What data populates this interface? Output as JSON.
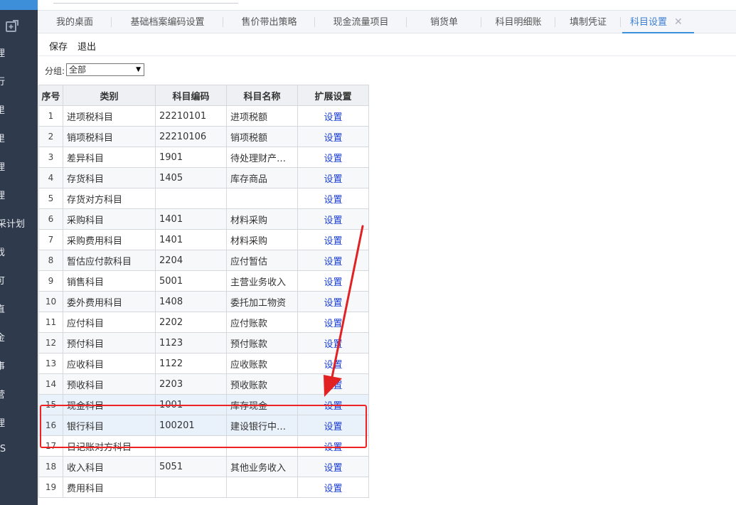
{
  "sidebar": {
    "items": [
      "理",
      "行",
      "里",
      "里",
      "理",
      "理",
      "采计划",
      "戏",
      "可",
      "直",
      "金",
      "事",
      "营",
      "理",
      "IS"
    ]
  },
  "tabs": [
    {
      "label": "我的桌面"
    },
    {
      "label": "基础档案编码设置"
    },
    {
      "label": "售价带出策略"
    },
    {
      "label": "现金流量项目"
    },
    {
      "label": "销货单"
    },
    {
      "label": "科目明细账"
    },
    {
      "label": "填制凭证"
    },
    {
      "label": "科目设置",
      "active": true,
      "close": "✕"
    }
  ],
  "toolbar": {
    "save_label": "保存",
    "exit_label": "退出"
  },
  "filter": {
    "label": "分组:",
    "selected": "全部"
  },
  "table": {
    "headers": [
      "序号",
      "类别",
      "科目编码",
      "科目名称",
      "扩展设置"
    ],
    "rows": [
      {
        "idx": "1",
        "category": "进项税科目",
        "code": "22210101",
        "name": "进项税额",
        "action": "设置"
      },
      {
        "idx": "2",
        "category": "销项税科目",
        "code": "22210106",
        "name": "销项税额",
        "action": "设置"
      },
      {
        "idx": "3",
        "category": "差异科目",
        "code": "1901",
        "name": "待处理财产…",
        "action": "设置"
      },
      {
        "idx": "4",
        "category": "存货科目",
        "code": "1405",
        "name": "库存商品",
        "action": "设置"
      },
      {
        "idx": "5",
        "category": "存货对方科目",
        "code": "",
        "name": "",
        "action": "设置"
      },
      {
        "idx": "6",
        "category": "采购科目",
        "code": "1401",
        "name": "材料采购",
        "action": "设置"
      },
      {
        "idx": "7",
        "category": "采购费用科目",
        "code": "1401",
        "name": "材料采购",
        "action": "设置"
      },
      {
        "idx": "8",
        "category": "暂估应付款科目",
        "code": "2204",
        "name": "应付暂估",
        "action": "设置"
      },
      {
        "idx": "9",
        "category": "销售科目",
        "code": "5001",
        "name": "主营业务收入",
        "action": "设置"
      },
      {
        "idx": "10",
        "category": "委外费用科目",
        "code": "1408",
        "name": "委托加工物资",
        "action": "设置"
      },
      {
        "idx": "11",
        "category": "应付科目",
        "code": "2202",
        "name": "应付账款",
        "action": "设置"
      },
      {
        "idx": "12",
        "category": "预付科目",
        "code": "1123",
        "name": "预付账款",
        "action": "设置"
      },
      {
        "idx": "13",
        "category": "应收科目",
        "code": "1122",
        "name": "应收账款",
        "action": "设置"
      },
      {
        "idx": "14",
        "category": "预收科目",
        "code": "2203",
        "name": "预收账款",
        "action": "设置"
      },
      {
        "idx": "15",
        "category": "现金科目",
        "code": "1001",
        "name": "库存现金",
        "action": "设置"
      },
      {
        "idx": "16",
        "category": "银行科目",
        "code": "100201",
        "name": "建设银行中…",
        "action": "设置"
      },
      {
        "idx": "17",
        "category": "日记账对方科目",
        "code": "",
        "name": "",
        "action": "设置"
      },
      {
        "idx": "18",
        "category": "收入科目",
        "code": "5051",
        "name": "其他业务收入",
        "action": "设置"
      },
      {
        "idx": "19",
        "category": "费用科目",
        "code": "",
        "name": "",
        "action": "设置"
      }
    ]
  },
  "annotation": {
    "color": "#e22222"
  }
}
